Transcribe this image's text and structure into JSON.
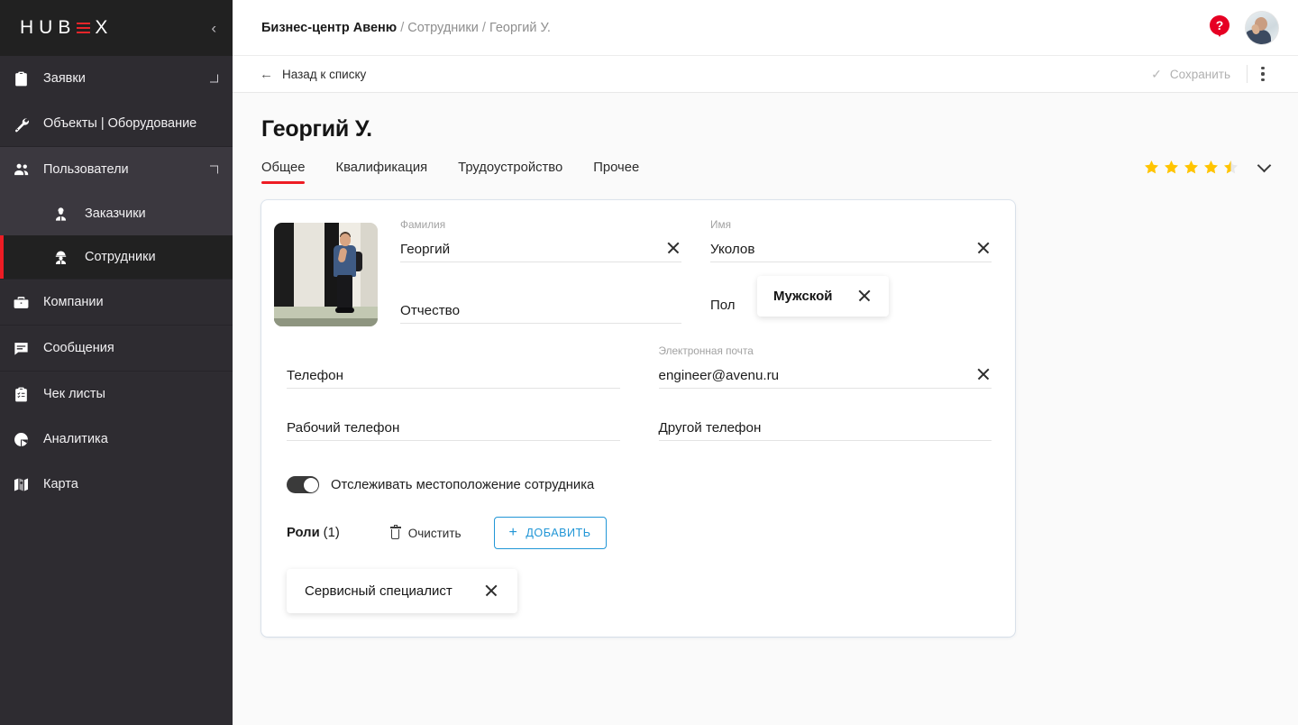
{
  "sidebar": {
    "logo": {
      "part1": "HUB",
      "part2": "X"
    },
    "collapse_icon": "chevron-left-icon",
    "groups": [
      {
        "items": [
          {
            "label": "Заявки",
            "icon": "clipboard-icon",
            "expandable": true,
            "active": false
          },
          {
            "label": "Объекты | Оборудование",
            "icon": "wrench-icon",
            "expandable": false,
            "active": false
          }
        ]
      },
      {
        "items": [
          {
            "label": "Пользователи",
            "icon": "users-icon",
            "expandable": true,
            "active": false,
            "open": true
          }
        ],
        "children": [
          {
            "label": "Заказчики",
            "icon": "customer-icon",
            "active": false
          },
          {
            "label": "Сотрудники",
            "icon": "worker-icon",
            "active": true
          }
        ]
      },
      {
        "items": [
          {
            "label": "Компании",
            "icon": "briefcase-icon",
            "expandable": false,
            "active": false
          }
        ]
      },
      {
        "items": [
          {
            "label": "Сообщения",
            "icon": "message-icon",
            "expandable": false,
            "active": false
          }
        ]
      },
      {
        "items": [
          {
            "label": "Чек листы",
            "icon": "checklist-icon",
            "expandable": false,
            "active": false
          },
          {
            "label": "Аналитика",
            "icon": "pie-chart-icon",
            "expandable": false,
            "active": false
          },
          {
            "label": "Карта",
            "icon": "map-icon",
            "expandable": false,
            "active": false
          }
        ]
      }
    ]
  },
  "topbar": {
    "breadcrumb_root": "Бизнес-центр Авеню",
    "breadcrumb_sep1": " / ",
    "breadcrumb_section": "Сотрудники",
    "breadcrumb_sep2": " / ",
    "breadcrumb_current": "Георгий У.",
    "help_icon": "help-pin-icon",
    "avatar_icon": "user-avatar"
  },
  "actionbar": {
    "back_label": "Назад к списку",
    "back_icon": "arrow-left-icon",
    "save_label": "Сохранить",
    "save_icon": "check-icon",
    "more_icon": "kebab-menu-icon"
  },
  "page": {
    "title": "Георгий У.",
    "tabs": [
      {
        "label": "Общее",
        "active": true
      },
      {
        "label": "Квалификация",
        "active": false
      },
      {
        "label": "Трудоустройство",
        "active": false
      },
      {
        "label": "Прочее",
        "active": false
      }
    ],
    "rating": {
      "value": 4.5,
      "max": 5,
      "full": 4,
      "half": 1,
      "expand_icon": "chevron-down-icon"
    }
  },
  "form": {
    "photo_alt": "employee-photo",
    "surname": {
      "label": "Фамилия",
      "value": "Георгий",
      "clearable": true
    },
    "name": {
      "label": "Имя",
      "value": "Уколов",
      "clearable": true
    },
    "patronymic": {
      "label": "",
      "value": "Отчество",
      "clearable": false
    },
    "gender": {
      "label": "Пол",
      "value": "Мужской",
      "clearable": true
    },
    "phone": {
      "label": "",
      "value": "Телефон",
      "clearable": false
    },
    "email": {
      "label": "Электронная почта",
      "value": "engineer@avenu.ru",
      "clearable": true
    },
    "work_phone": {
      "label": "",
      "value": "Рабочий телефон",
      "clearable": false
    },
    "other_phone": {
      "label": "",
      "value": "Другой телефон",
      "clearable": false
    },
    "track_toggle": {
      "label": "Отслеживать местоположение сотрудника",
      "on": true
    },
    "roles": {
      "title": "Роли",
      "count": "(1)",
      "clear_label": "Очистить",
      "clear_icon": "trash-icon",
      "add_label": "ДОБАВИТЬ",
      "add_icon": "plus-icon",
      "items": [
        {
          "label": "Сервисный специалист"
        }
      ]
    }
  },
  "colors": {
    "accent_red": "#ed1c24",
    "sidebar_bg": "#2e2c31",
    "sidebar_active": "#212121",
    "link_blue": "#2196d6",
    "star_gold": "#ffc400",
    "page_bg": "#fafafa"
  }
}
